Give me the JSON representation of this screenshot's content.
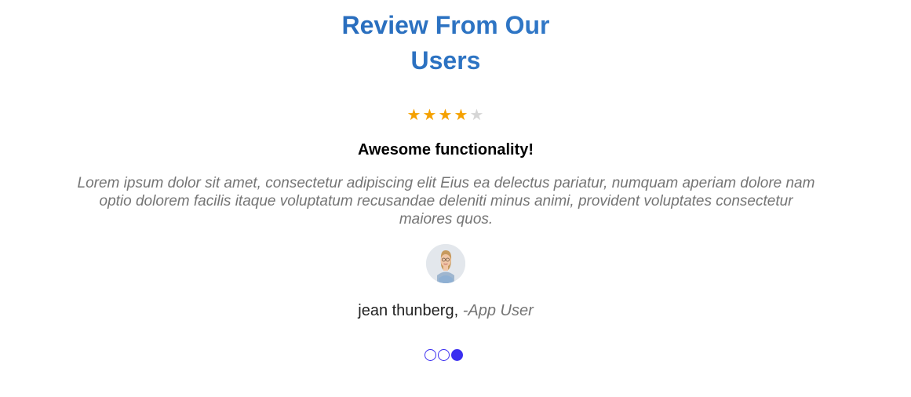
{
  "section": {
    "title_line1": "Review From Our",
    "title_line2": "Users"
  },
  "review": {
    "rating": 4,
    "rating_max": 5,
    "headline": "Awesome functionality!",
    "body": "Lorem ipsum dolor sit amet, consectetur adipiscing elit Eius ea delectus pariatur, numquam aperiam dolore nam optio dolorem facilis itaque voluptatum recusandae deleniti minus animi, provident voluptates consectetur maiores quos.",
    "author_name": "jean thunberg,",
    "author_role": "-App User",
    "avatar_icon": "user-avatar-photo"
  },
  "carousel": {
    "slide_count": 3,
    "active_index": 2
  },
  "colors": {
    "title_gradient_start": "#1f5fb0",
    "title_gradient_end": "#3a86d4",
    "star_filled": "#f5a100",
    "star_empty": "#d6d6d6",
    "dot_accent": "#3b2ff0"
  }
}
